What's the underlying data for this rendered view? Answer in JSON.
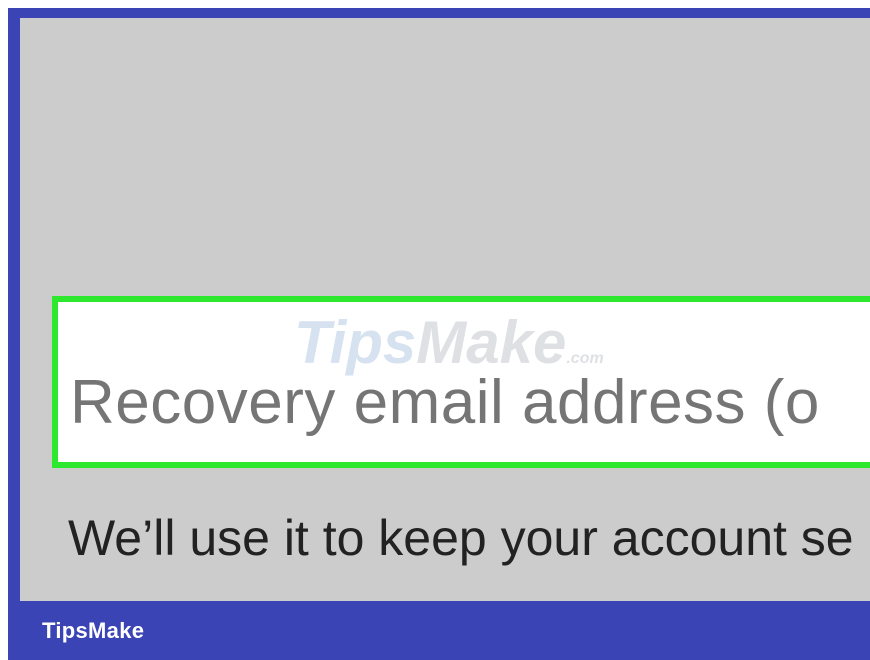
{
  "recovery_field": {
    "placeholder": "Recovery email address (o",
    "highlight_color": "#2ee82e"
  },
  "helper_text": "We’ll use it to keep your account se",
  "watermark": {
    "tips": "Tips",
    "make": "Make",
    "com": ".com"
  },
  "footer": {
    "brand": "TipsMake",
    "bar_color": "#3a44b4"
  }
}
